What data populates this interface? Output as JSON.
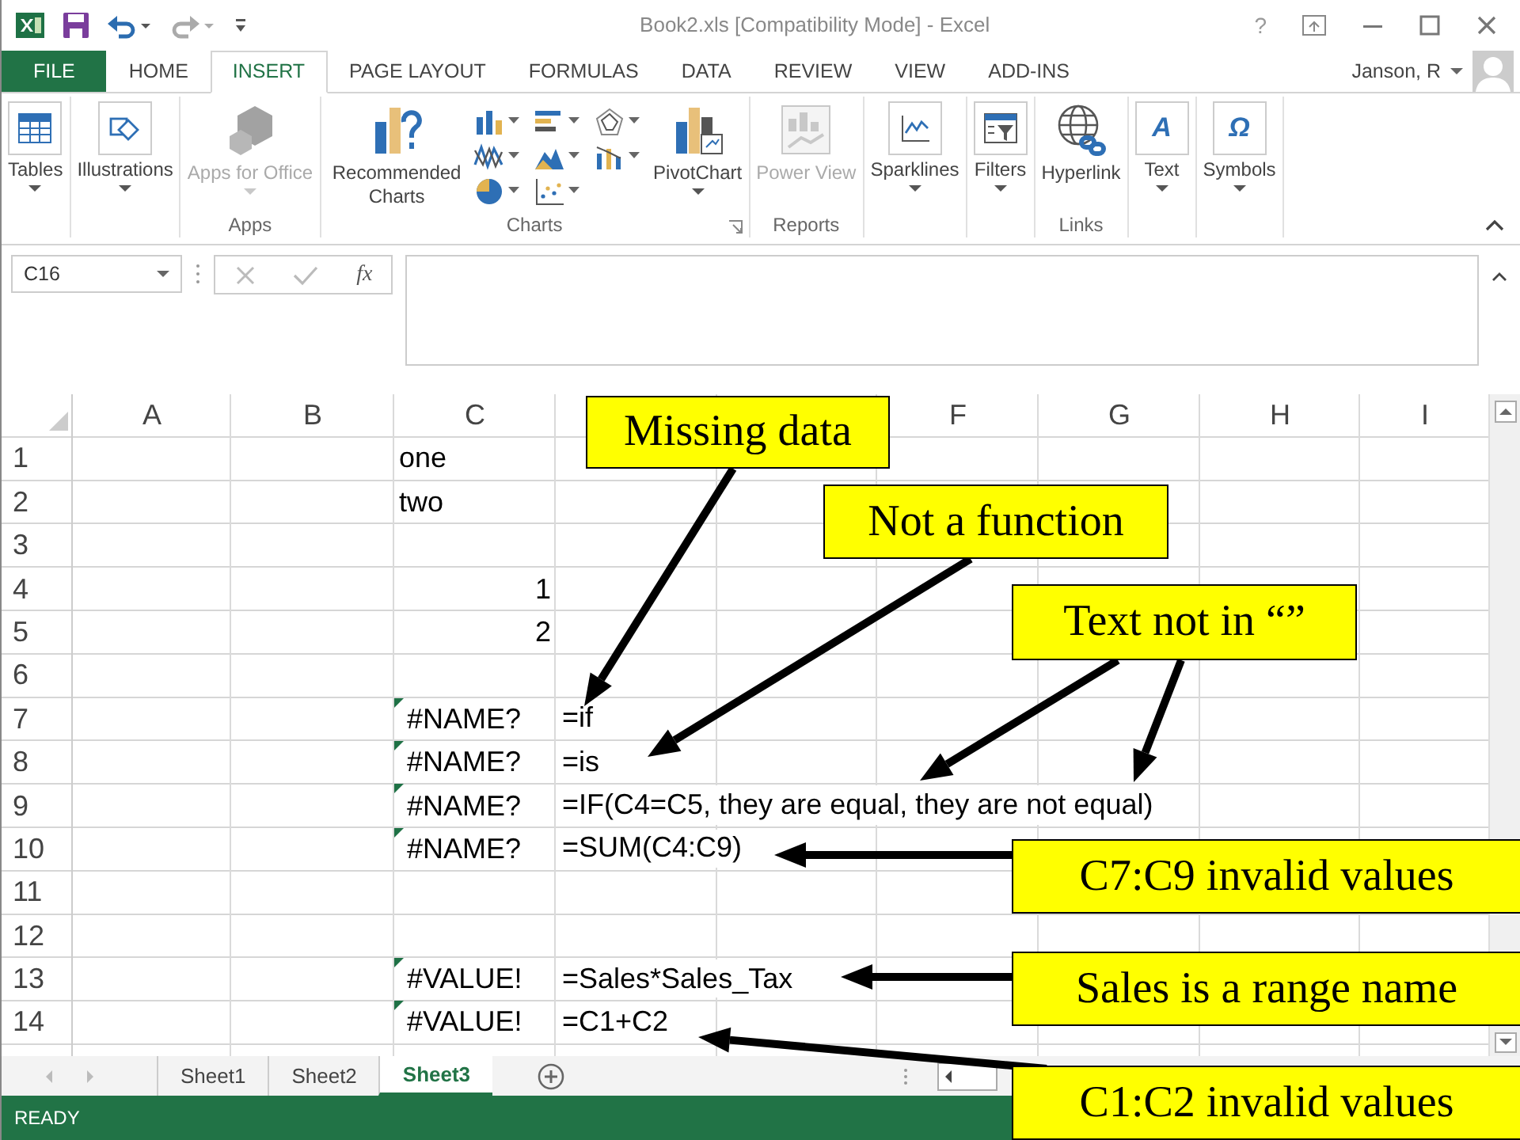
{
  "window": {
    "title": "Book2.xls  [Compatibility Mode] - Excel",
    "help": "?",
    "user": "Janson, R"
  },
  "tabs": [
    {
      "label": "FILE",
      "kind": "file",
      "selected": false
    },
    {
      "label": "HOME",
      "kind": "tab",
      "selected": false
    },
    {
      "label": "INSERT",
      "kind": "tab",
      "selected": true
    },
    {
      "label": "PAGE LAYOUT",
      "kind": "tab",
      "selected": false
    },
    {
      "label": "FORMULAS",
      "kind": "tab",
      "selected": false
    },
    {
      "label": "DATA",
      "kind": "tab",
      "selected": false
    },
    {
      "label": "REVIEW",
      "kind": "tab",
      "selected": false
    },
    {
      "label": "VIEW",
      "kind": "tab",
      "selected": false
    },
    {
      "label": "ADD-INS",
      "kind": "tab",
      "selected": false
    }
  ],
  "ribbon": {
    "groups": [
      {
        "items": [
          {
            "label": "Tables",
            "kind": "boxed",
            "dropdown": true,
            "disabled": false
          }
        ]
      },
      {
        "items": [
          {
            "label": "Illustrations",
            "kind": "boxed",
            "dropdown": true,
            "disabled": false
          }
        ]
      },
      {
        "label": "Apps",
        "items": [
          {
            "label": "Apps for Office",
            "kind": "large",
            "dropdown": true,
            "disabled": true
          }
        ]
      },
      {
        "label": "Charts",
        "launcher": true,
        "items": [
          {
            "label": "Recommended Charts",
            "kind": "large",
            "dropdown": false,
            "disabled": false
          },
          {
            "kind": "gallery"
          },
          {
            "label": "PivotChart",
            "kind": "large",
            "dropdown": true,
            "disabled": false
          }
        ]
      },
      {
        "label": "Reports",
        "items": [
          {
            "label": "Power View",
            "kind": "large",
            "dropdown": false,
            "disabled": true
          }
        ]
      },
      {
        "items": [
          {
            "label": "Sparklines",
            "kind": "boxed",
            "dropdown": true,
            "disabled": false
          }
        ]
      },
      {
        "items": [
          {
            "label": "Filters",
            "kind": "boxed",
            "dropdown": true,
            "disabled": false
          }
        ]
      },
      {
        "label": "Links",
        "items": [
          {
            "label": "Hyperlink",
            "kind": "large",
            "dropdown": false,
            "disabled": false
          }
        ]
      },
      {
        "items": [
          {
            "label": "Text",
            "kind": "boxed",
            "glyph": "A",
            "dropdown": true,
            "disabled": false
          }
        ]
      },
      {
        "items": [
          {
            "label": "Symbols",
            "kind": "boxed",
            "glyph": "Ω",
            "dropdown": true,
            "disabled": false
          }
        ]
      }
    ]
  },
  "formula_bar": {
    "name_box": "C16",
    "function_label": "fx"
  },
  "grid": {
    "columns": [
      "A",
      "B",
      "C",
      null,
      null,
      "F",
      "G",
      "H",
      "I"
    ],
    "rows": [
      {
        "label": "1",
        "c": {
          "text": "one",
          "kind": "text"
        }
      },
      {
        "label": "2",
        "c": {
          "text": "two",
          "kind": "text"
        }
      },
      {
        "label": "3"
      },
      {
        "label": "4",
        "c": {
          "text": "1",
          "kind": "number"
        }
      },
      {
        "label": "5",
        "c": {
          "text": "2",
          "kind": "number"
        }
      },
      {
        "label": "6"
      },
      {
        "label": "7",
        "c": {
          "text": "#NAME?",
          "kind": "error"
        },
        "d": "=if"
      },
      {
        "label": "8",
        "c": {
          "text": "#NAME?",
          "kind": "error"
        },
        "d": "=is"
      },
      {
        "label": "9",
        "c": {
          "text": "#NAME?",
          "kind": "error"
        },
        "d": "=IF(C4=C5, they are equal, they are not equal)"
      },
      {
        "label": "10",
        "c": {
          "text": "#NAME?",
          "kind": "error"
        },
        "d": "=SUM(C4:C9)"
      },
      {
        "label": "11"
      },
      {
        "label": "12"
      },
      {
        "label": "13",
        "c": {
          "text": "#VALUE!",
          "kind": "error"
        },
        "d": "=Sales*Sales_Tax"
      },
      {
        "label": "14",
        "c": {
          "text": "#VALUE!",
          "kind": "error"
        },
        "d": "=C1+C2"
      }
    ]
  },
  "sheets": [
    {
      "label": "Sheet1",
      "selected": false
    },
    {
      "label": "Sheet2",
      "selected": false
    },
    {
      "label": "Sheet3",
      "selected": true
    }
  ],
  "status_bar": {
    "text": "READY"
  },
  "callouts": [
    {
      "text": "Missing data"
    },
    {
      "text": "Not a function"
    },
    {
      "text": "Text not in “”"
    },
    {
      "text": "C7:C9 invalid values"
    },
    {
      "text": "Sales is a range name"
    },
    {
      "text": "C1:C2 invalid values"
    }
  ]
}
